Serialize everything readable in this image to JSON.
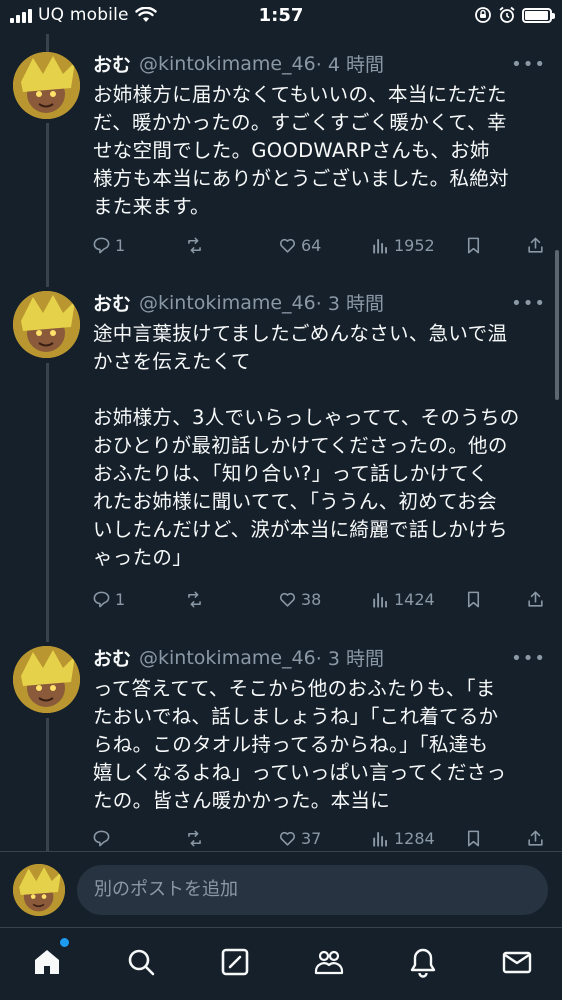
{
  "status_bar": {
    "carrier": "UQ mobile",
    "time": "1:57",
    "battery_level": 0.95
  },
  "posts": [
    {
      "name": "おむ",
      "handle": "@kintokimame_46",
      "time": "· 4 時間",
      "text": "お姉様方に届かなくてもいいの、本当にただた\nだ、暖かかったの。すごくすごく暖かくて、幸\nせな空間でした。GOODWARPさんも、お姉\n様方も本当にありがとうございました。私絶対\nまた来ます。",
      "replies": "1",
      "likes": "64",
      "views": "1952"
    },
    {
      "name": "おむ",
      "handle": "@kintokimame_46",
      "time": "· 3 時間",
      "text": "途中言葉抜けてましたごめんなさい、急いで温\nかさを伝えたくて\n\nお姉様方、3人でいらっしゃってて、そのうちの\nおひとりが最初話しかけてくださったの。他の\nおふたりは、「知り合い?」って話しかけてく\nれたお姉様に聞いてて、「ううん、初めてお会\nいしたんだけど、涙が本当に綺麗で話しかけち\nゃったの」",
      "replies": "1",
      "likes": "38",
      "views": "1424"
    },
    {
      "name": "おむ",
      "handle": "@kintokimame_46",
      "time": "· 3 時間",
      "text": "って答えてて、そこから他のおふたりも、「ま\nたおいでね、話しましょうね」「これ着てるか\nらね。このタオル持ってるからね。」「私達も\n嬉しくなるよね」っていっぱい言ってくださっ\nたの。皆さん暖かかった。本当に",
      "replies": "",
      "likes": "37",
      "views": "1284"
    }
  ],
  "more_label": "•••",
  "compose": {
    "placeholder": "別のポストを追加"
  },
  "tabs": [
    "home-icon",
    "search-icon",
    "compose-icon",
    "communities-icon",
    "notifications-icon",
    "messages-icon"
  ],
  "colors": {
    "background": "#15202b",
    "secondary_text": "#8b98a5",
    "accent": "#1d9bf0"
  }
}
